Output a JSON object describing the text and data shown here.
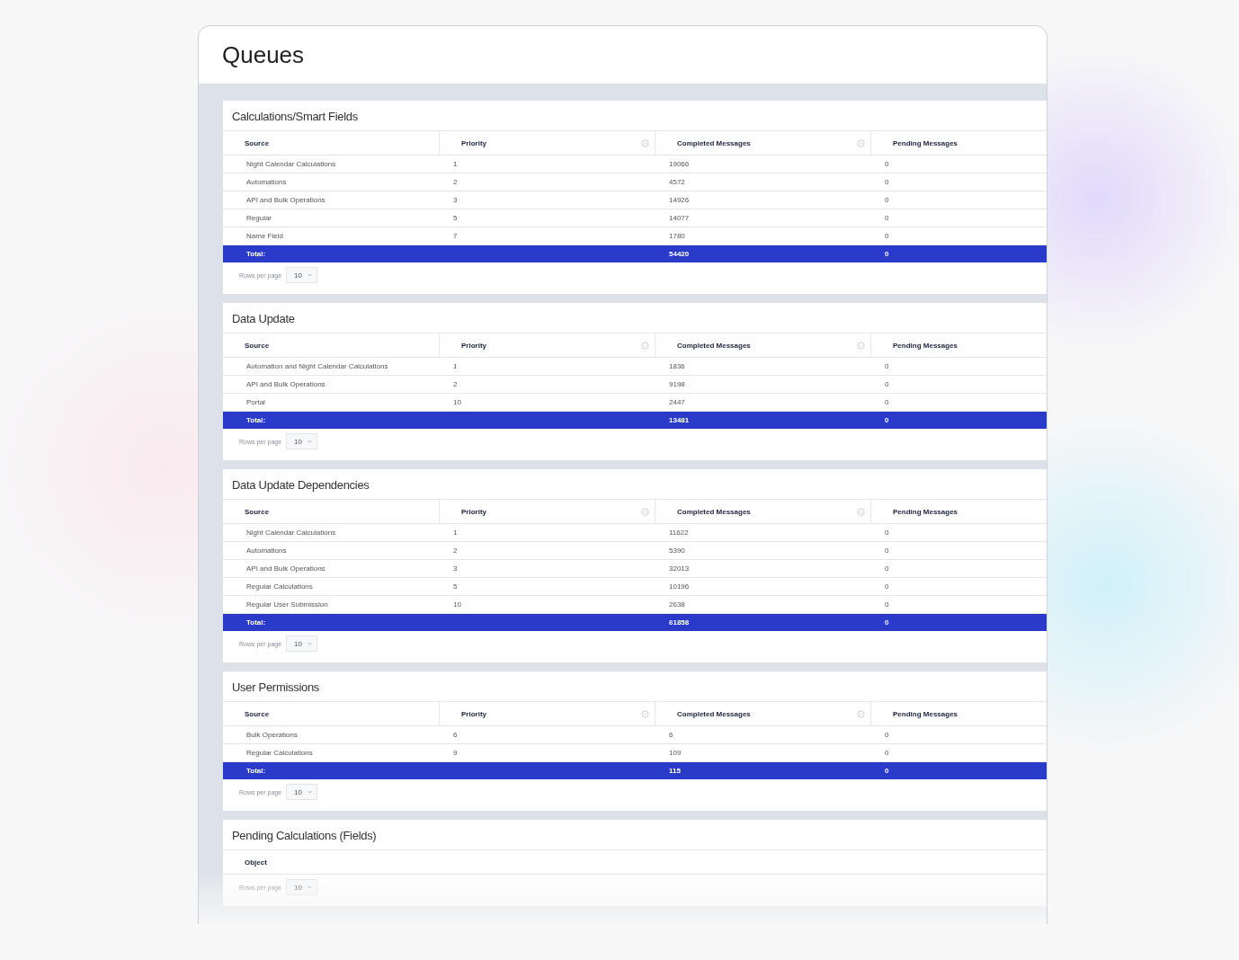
{
  "window": {
    "title": "Queues"
  },
  "panels": [
    {
      "title": "Calculations/Smart Fields",
      "columns": [
        {
          "label": "Source",
          "info_icon": false
        },
        {
          "label": "Priority",
          "info_icon": true
        },
        {
          "label": "Completed Messages",
          "info_icon": true
        },
        {
          "label": "Pending Messages",
          "info_icon": false
        }
      ],
      "rows": [
        [
          "Night Calendar Calculations",
          "1",
          "19066",
          "0"
        ],
        [
          "Automations",
          "2",
          "4572",
          "0"
        ],
        [
          "API and Bulk Operations",
          "3",
          "14926",
          "0"
        ],
        [
          "Regular",
          "5",
          "14077",
          "0"
        ],
        [
          "Name Field",
          "7",
          "1780",
          "0"
        ]
      ],
      "total": {
        "label": "Total:",
        "completed": "54420",
        "pending": "0"
      },
      "rows_per_page": {
        "label": "Rows per page",
        "value": "10"
      }
    },
    {
      "title": "Data Update",
      "columns": [
        {
          "label": "Source",
          "info_icon": false
        },
        {
          "label": "Priority",
          "info_icon": true
        },
        {
          "label": "Completed Messages",
          "info_icon": true
        },
        {
          "label": "Pending Messages",
          "info_icon": false
        }
      ],
      "rows": [
        [
          "Automation and Night Calendar Calculations",
          "1",
          "1836",
          "0"
        ],
        [
          "API and Bulk Operations",
          "2",
          "9198",
          "0"
        ],
        [
          "Portal",
          "10",
          "2447",
          "0"
        ]
      ],
      "total": {
        "label": "Total:",
        "completed": "13481",
        "pending": "0"
      },
      "rows_per_page": {
        "label": "Rows per page",
        "value": "10"
      }
    },
    {
      "title": "Data Update Dependencies",
      "columns": [
        {
          "label": "Source",
          "info_icon": false
        },
        {
          "label": "Priority",
          "info_icon": true
        },
        {
          "label": "Completed Messages",
          "info_icon": true
        },
        {
          "label": "Pending Messages",
          "info_icon": false
        }
      ],
      "rows": [
        [
          "Night Calendar Calculations",
          "1",
          "11622",
          "0"
        ],
        [
          "Automations",
          "2",
          "5390",
          "0"
        ],
        [
          "API and Bulk Operations",
          "3",
          "32013",
          "0"
        ],
        [
          "Regular Calculations",
          "5",
          "10196",
          "0"
        ],
        [
          "Regular User Submission",
          "10",
          "2638",
          "0"
        ]
      ],
      "total": {
        "label": "Total:",
        "completed": "61858",
        "pending": "0"
      },
      "rows_per_page": {
        "label": "Rows per page",
        "value": "10"
      }
    },
    {
      "title": "User Permissions",
      "columns": [
        {
          "label": "Source",
          "info_icon": false
        },
        {
          "label": "Priority",
          "info_icon": true
        },
        {
          "label": "Completed Messages",
          "info_icon": true
        },
        {
          "label": "Pending Messages",
          "info_icon": false
        }
      ],
      "rows": [
        [
          "Bulk Operations",
          "6",
          "6",
          "0"
        ],
        [
          "Regular Calculations",
          "9",
          "109",
          "0"
        ]
      ],
      "total": {
        "label": "Total:",
        "completed": "115",
        "pending": "0"
      },
      "rows_per_page": {
        "label": "Rows per page",
        "value": "10"
      }
    },
    {
      "title": "Pending Calculations (Fields)",
      "columns": [
        {
          "label": "Object",
          "info_icon": false
        }
      ],
      "rows_per_page": {
        "label": "Rows per page",
        "value": "10"
      }
    }
  ]
}
